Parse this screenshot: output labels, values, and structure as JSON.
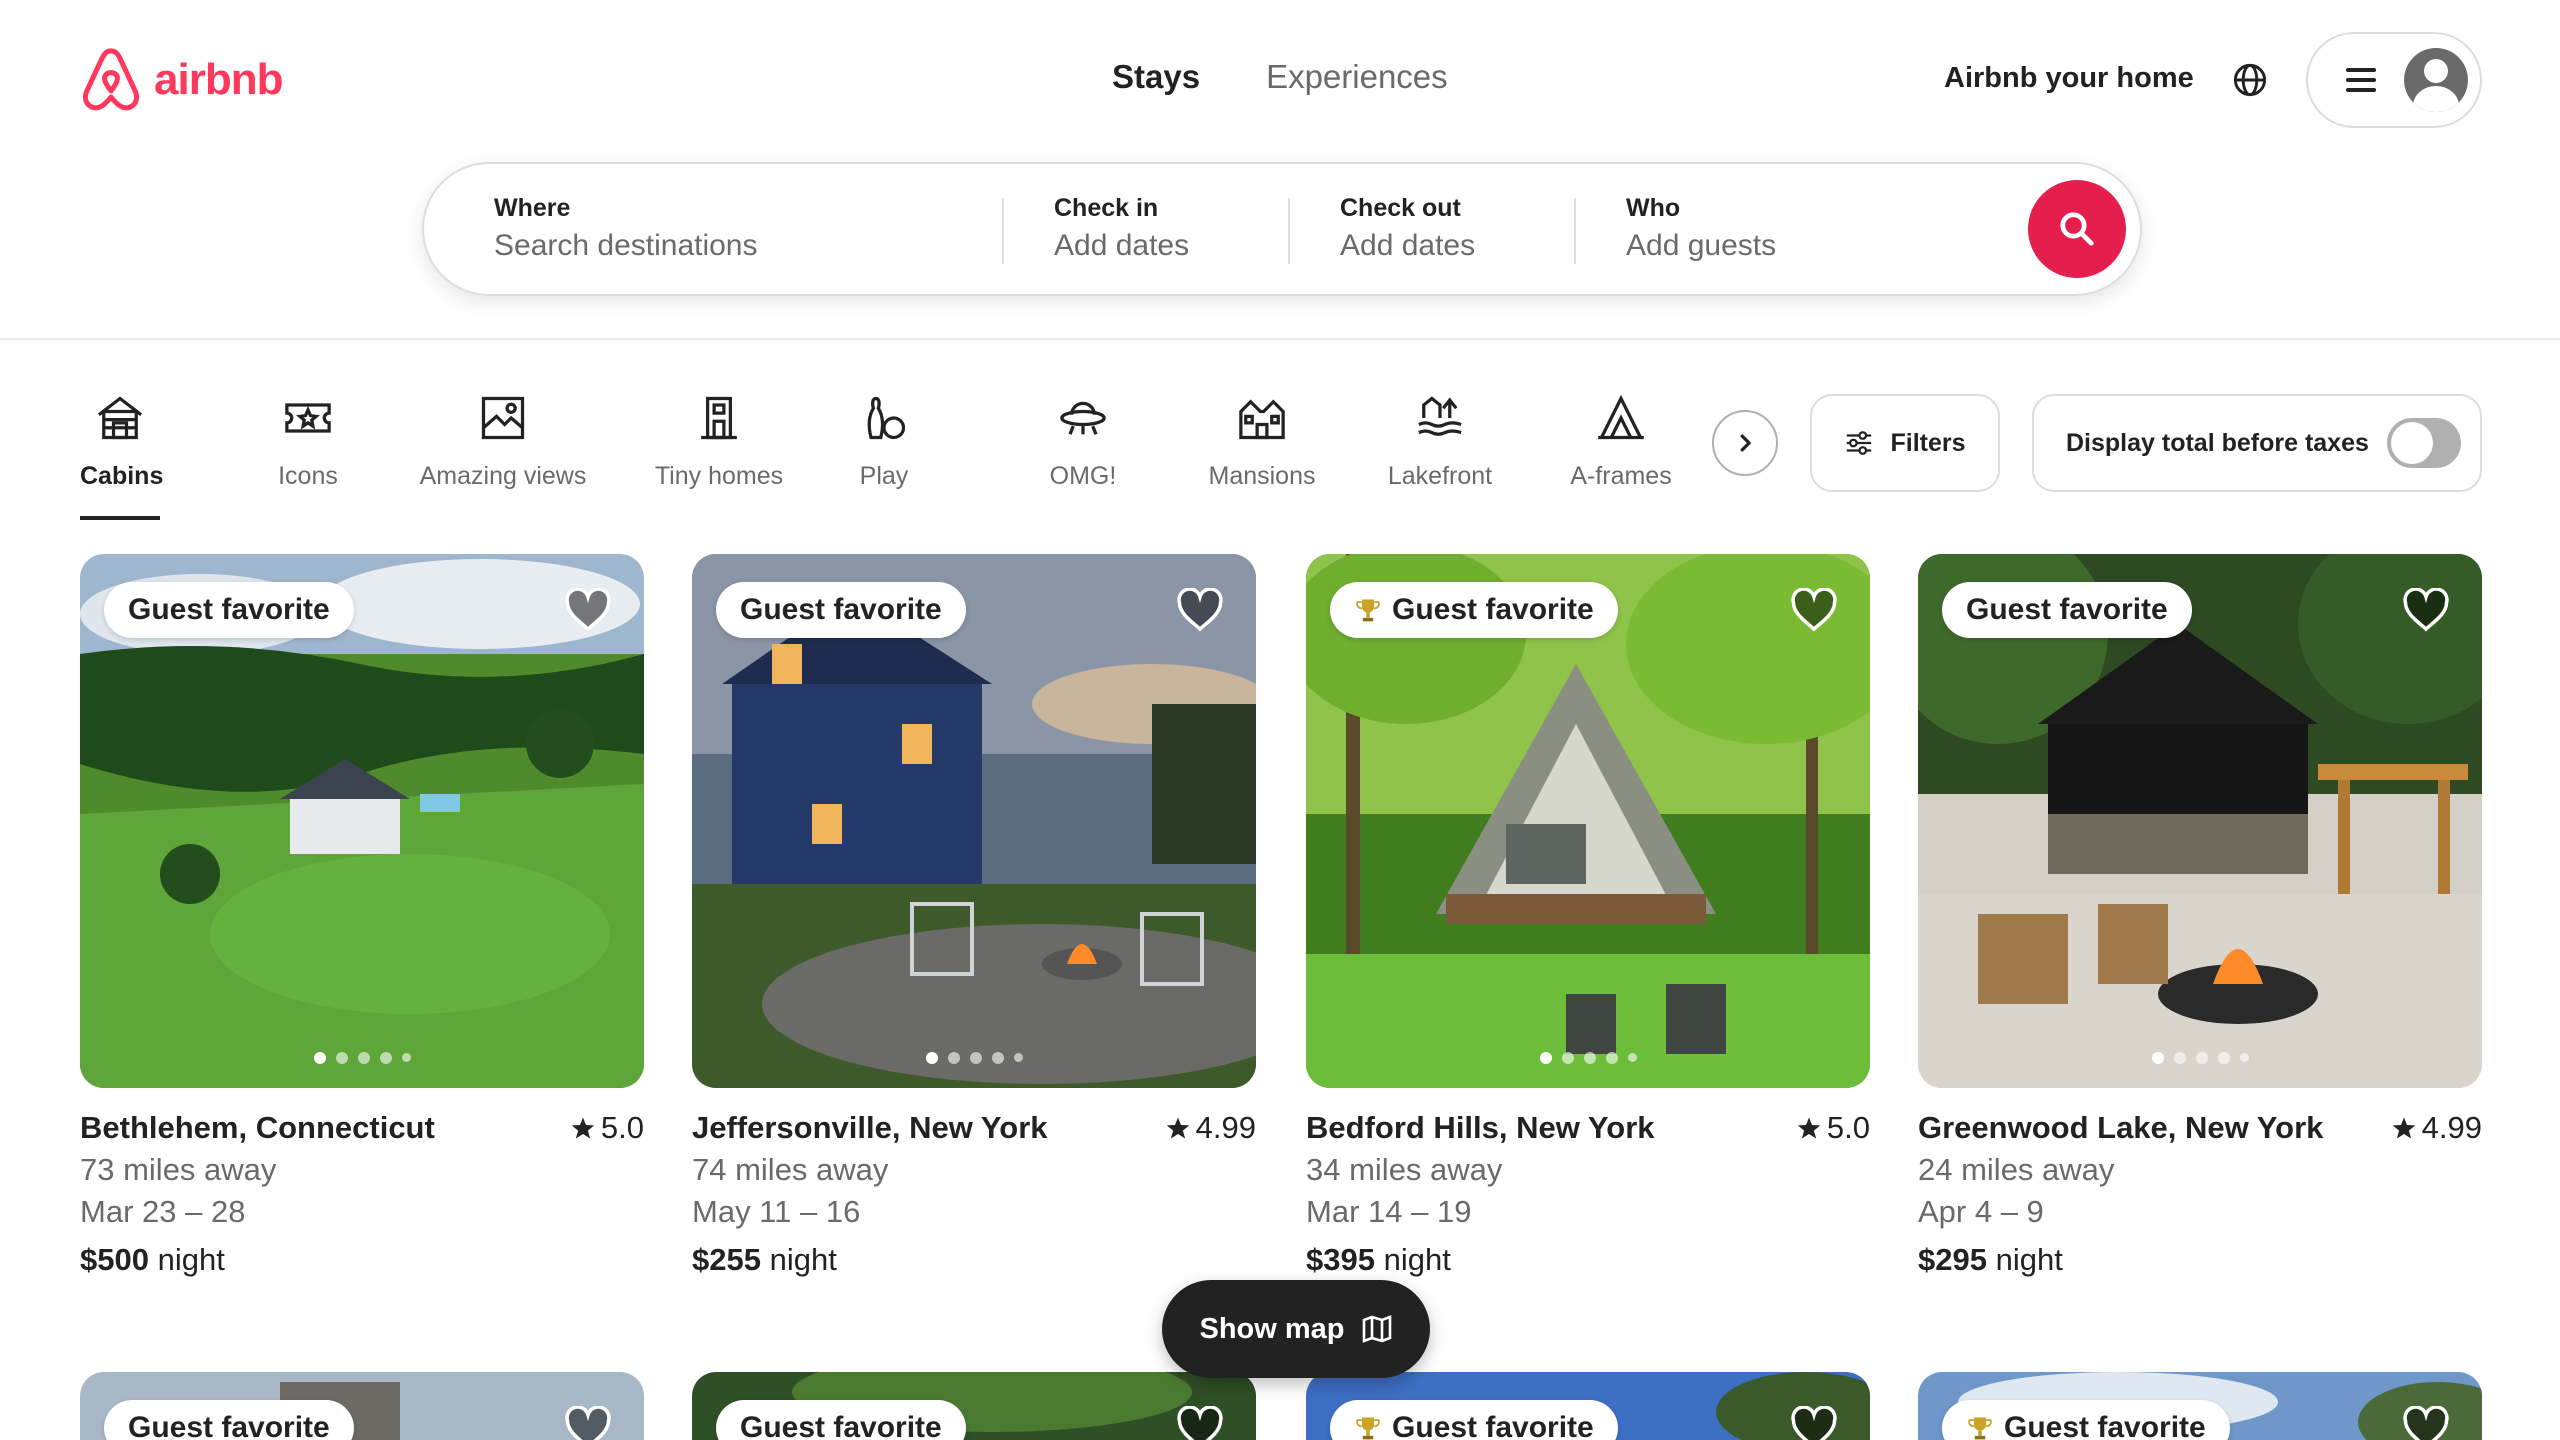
{
  "brand": {
    "name": "airbnb",
    "color": "#ff385c"
  },
  "nav": {
    "tabs": [
      {
        "label": "Stays",
        "active": true
      },
      {
        "label": "Experiences",
        "active": false
      }
    ],
    "host_link": "Airbnb your home",
    "globe_icon": "globe-icon",
    "menu_icon": "hamburger-icon",
    "avatar_icon": "user-avatar-icon"
  },
  "search": {
    "where": {
      "label": "Where",
      "placeholder": "Search destinations"
    },
    "check_in": {
      "label": "Check in",
      "value": "Add dates"
    },
    "check_out": {
      "label": "Check out",
      "value": "Add dates"
    },
    "who": {
      "label": "Who",
      "value": "Add guests"
    },
    "button_icon": "search-icon",
    "button_color": "#e61e4d"
  },
  "categories": [
    {
      "label": "Cabins",
      "icon": "cabin-icon",
      "active": true
    },
    {
      "label": "Icons",
      "icon": "ticket-icon",
      "active": false
    },
    {
      "label": "Amazing views",
      "icon": "picture-frame-icon",
      "active": false
    },
    {
      "label": "Tiny homes",
      "icon": "tiny-home-icon",
      "active": false
    },
    {
      "label": "Play",
      "icon": "bowling-icon",
      "active": false
    },
    {
      "label": "OMG!",
      "icon": "ufo-icon",
      "active": false
    },
    {
      "label": "Mansions",
      "icon": "mansion-icon",
      "active": false
    },
    {
      "label": "Lakefront",
      "icon": "lakefront-icon",
      "active": false
    },
    {
      "label": "A-frames",
      "icon": "a-frame-icon",
      "active": false
    }
  ],
  "filters": {
    "label": "Filters",
    "icon": "sliders-icon"
  },
  "tax_toggle": {
    "label": "Display total before taxes",
    "on": false
  },
  "listings": [
    {
      "badge": "Guest favorite",
      "trophy": false,
      "location": "Bethlehem, Connecticut",
      "rating": "5.0",
      "distance": "73 miles away",
      "dates": "Mar 23 – 28",
      "price": "$500",
      "price_unit": "night"
    },
    {
      "badge": "Guest favorite",
      "trophy": false,
      "location": "Jeffersonville, New York",
      "rating": "4.99",
      "distance": "74 miles away",
      "dates": "May 11 – 16",
      "price": "$255",
      "price_unit": "night"
    },
    {
      "badge": "Guest favorite",
      "trophy": true,
      "location": "Bedford Hills, New York",
      "rating": "5.0",
      "distance": "34 miles away",
      "dates": "Mar 14 – 19",
      "price": "$395",
      "price_unit": "night"
    },
    {
      "badge": "Guest favorite",
      "trophy": false,
      "location": "Greenwood Lake, New York",
      "rating": "4.99",
      "distance": "24 miles away",
      "dates": "Apr 4 – 9",
      "price": "$295",
      "price_unit": "night"
    }
  ],
  "listings_row2": [
    {
      "badge": "Guest favorite",
      "trophy": false
    },
    {
      "badge": "Guest favorite",
      "trophy": false
    },
    {
      "badge": "Guest favorite",
      "trophy": true
    },
    {
      "badge": "Guest favorite",
      "trophy": true
    }
  ],
  "show_map": {
    "label": "Show map",
    "icon": "map-icon"
  }
}
